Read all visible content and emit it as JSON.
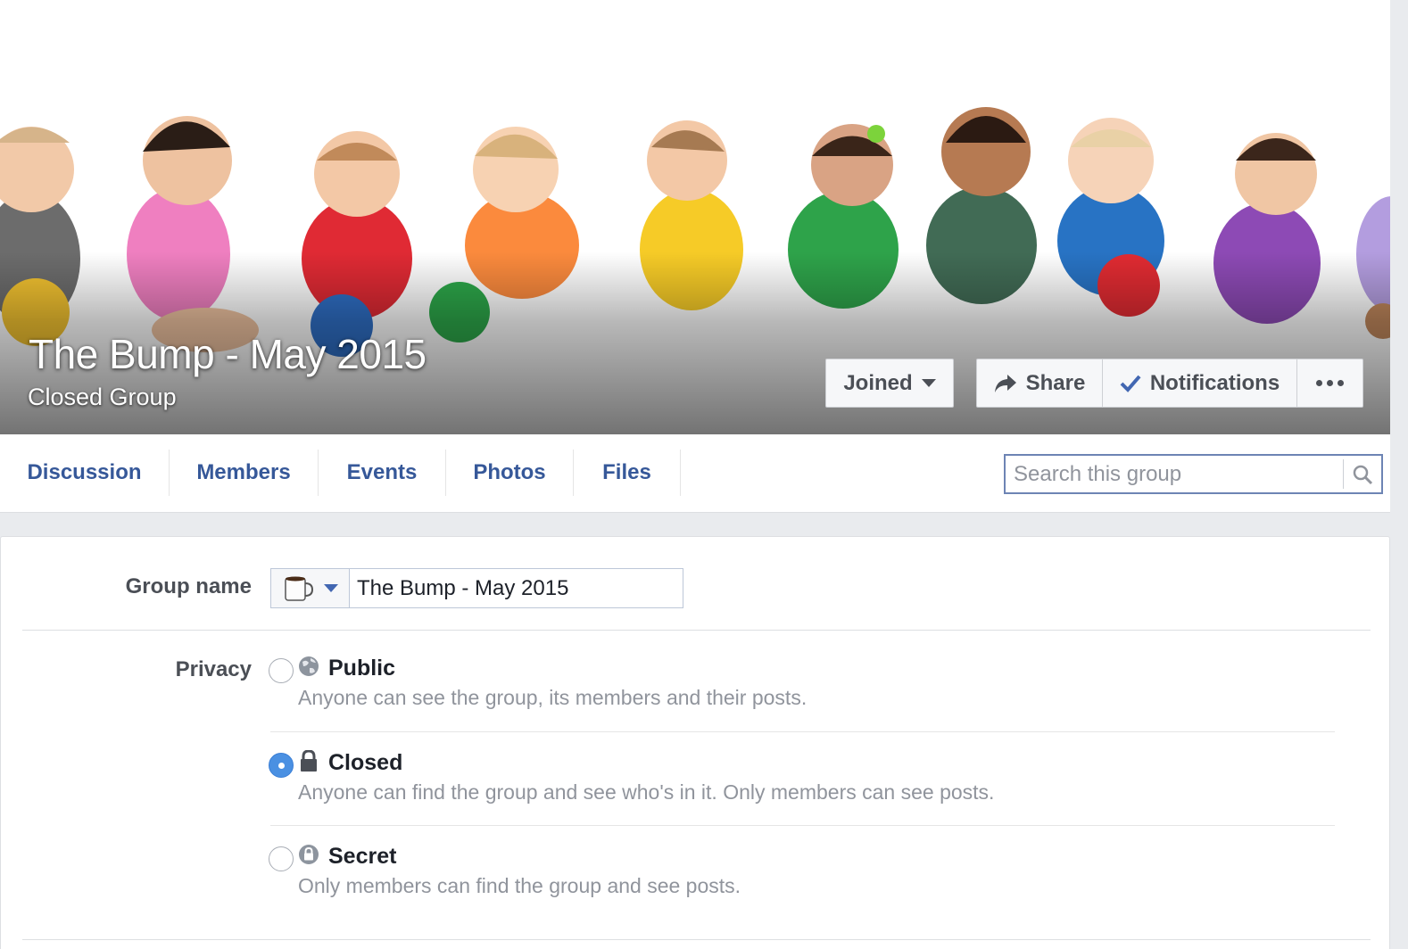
{
  "cover": {
    "title": "The Bump - May 2015",
    "subtitle": "Closed Group",
    "image": "cover-photo-babies"
  },
  "actions": {
    "joined_label": "Joined",
    "share_label": "Share",
    "notifications_label": "Notifications",
    "more_icon": "more-dots-icon"
  },
  "tabs": [
    "Discussion",
    "Members",
    "Events",
    "Photos",
    "Files"
  ],
  "search": {
    "placeholder": "Search this group",
    "value": ""
  },
  "settings": {
    "group_name_label": "Group name",
    "group_name_value": "The Bump - May 2015",
    "group_icon": "coffee-mug-icon",
    "privacy_label": "Privacy",
    "privacy_options": [
      {
        "title": "Public",
        "description": "Anyone can see the group, its members and their posts.",
        "icon": "globe-icon",
        "selected": false
      },
      {
        "title": "Closed",
        "description": "Anyone can find the group and see who's in it. Only members can see posts.",
        "icon": "lock-icon",
        "selected": true
      },
      {
        "title": "Secret",
        "description": "Only members can find the group and see posts.",
        "icon": "secret-lock-icon",
        "selected": false
      }
    ]
  },
  "colors": {
    "link_blue": "#365899",
    "accent_blue": "#4267b2",
    "radio_selected": "#4a90e2",
    "page_bg": "#e9ebee"
  }
}
